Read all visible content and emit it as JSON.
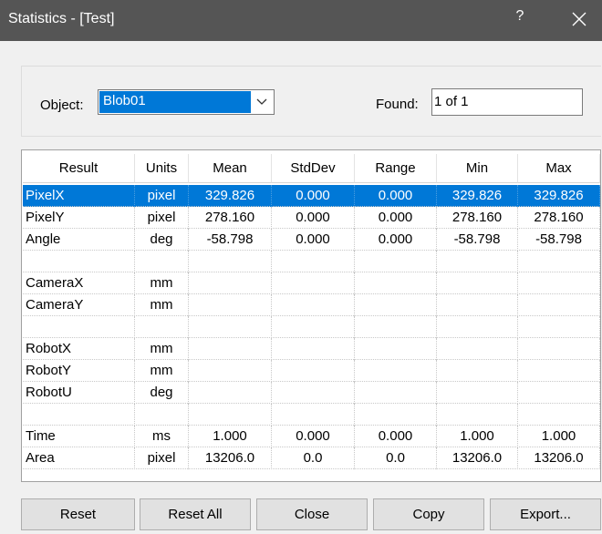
{
  "window": {
    "title": "Statistics - [Test]",
    "help_label": "?"
  },
  "object": {
    "label": "Object:",
    "selected": "Blob01"
  },
  "found": {
    "label": "Found:",
    "value": "1 of 1"
  },
  "table": {
    "headers": [
      "Result",
      "Units",
      "Mean",
      "StdDev",
      "Range",
      "Min",
      "Max"
    ],
    "rows": [
      [
        "PixelX",
        "pixel",
        "329.826",
        "0.000",
        "0.000",
        "329.826",
        "329.826"
      ],
      [
        "PixelY",
        "pixel",
        "278.160",
        "0.000",
        "0.000",
        "278.160",
        "278.160"
      ],
      [
        "Angle",
        "deg",
        "-58.798",
        "0.000",
        "0.000",
        "-58.798",
        "-58.798"
      ],
      [
        "",
        "",
        "",
        "",
        "",
        "",
        ""
      ],
      [
        "CameraX",
        "mm",
        "",
        "",
        "",
        "",
        ""
      ],
      [
        "CameraY",
        "mm",
        "",
        "",
        "",
        "",
        ""
      ],
      [
        "",
        "",
        "",
        "",
        "",
        "",
        ""
      ],
      [
        "RobotX",
        "mm",
        "",
        "",
        "",
        "",
        ""
      ],
      [
        "RobotY",
        "mm",
        "",
        "",
        "",
        "",
        ""
      ],
      [
        "RobotU",
        "deg",
        "",
        "",
        "",
        "",
        ""
      ],
      [
        "",
        "",
        "",
        "",
        "",
        "",
        ""
      ],
      [
        "Time",
        "ms",
        "1.000",
        "0.000",
        "0.000",
        "1.000",
        "1.000"
      ],
      [
        "Area",
        "pixel",
        "13206.0",
        "0.0",
        "0.0",
        "13206.0",
        "13206.0"
      ]
    ],
    "selected_row": 0
  },
  "buttons": {
    "reset": "Reset",
    "reset_all": "Reset All",
    "close": "Close",
    "copy": "Copy",
    "export": "Export..."
  },
  "colors": {
    "titlebar": "#555555",
    "selection": "#0078d7"
  }
}
